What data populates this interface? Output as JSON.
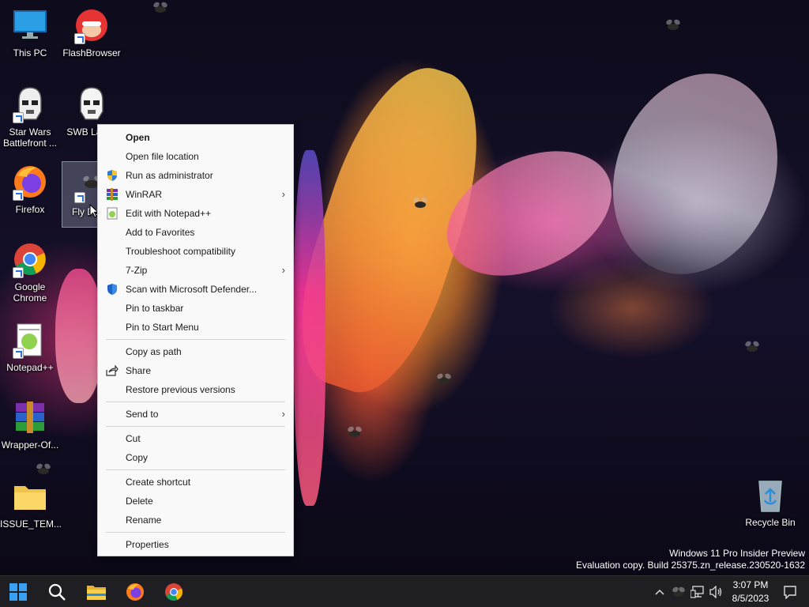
{
  "desktop": {
    "icons": [
      {
        "label": "This PC",
        "icon": "monitor-icon"
      },
      {
        "label": "FlashBrowser",
        "icon": "flash-browser-icon"
      },
      {
        "label": "Star Wars Battlefront ...",
        "icon": "stormtrooper-icon"
      },
      {
        "label": "SWB Launc",
        "icon": "stormtrooper-icon"
      },
      {
        "label": "Firefox",
        "icon": "firefox-icon"
      },
      {
        "label": "Fly Deskt",
        "icon": "fly-icon"
      },
      {
        "label": "Google Chrome",
        "icon": "chrome-icon"
      },
      {
        "label": "Notepad++",
        "icon": "notepad-plus-plus-icon"
      },
      {
        "label": "Wrapper-Of...",
        "icon": "winrar-archive-icon"
      },
      {
        "label": "ISSUE_TEM...",
        "icon": "folder-icon"
      },
      {
        "label": "Recycle Bin",
        "icon": "recycle-bin-icon"
      }
    ]
  },
  "context_menu": {
    "items": [
      {
        "label": "Open"
      },
      {
        "label": "Open file location"
      },
      {
        "label": "Run as administrator"
      },
      {
        "label": "WinRAR"
      },
      {
        "label": "Edit with Notepad++"
      },
      {
        "label": "Add to Favorites"
      },
      {
        "label": "Troubleshoot compatibility"
      },
      {
        "label": "7-Zip"
      },
      {
        "label": "Scan with Microsoft Defender..."
      },
      {
        "label": "Pin to taskbar"
      },
      {
        "label": "Pin to Start Menu"
      },
      {
        "label": "Copy as path"
      },
      {
        "label": "Share"
      },
      {
        "label": "Restore previous versions"
      },
      {
        "label": "Send to"
      },
      {
        "label": "Cut"
      },
      {
        "label": "Copy"
      },
      {
        "label": "Create shortcut"
      },
      {
        "label": "Delete"
      },
      {
        "label": "Rename"
      },
      {
        "label": "Properties"
      }
    ],
    "submenu_arrow": "›"
  },
  "watermark": {
    "line1": "Windows 11 Pro Insider Preview",
    "line2": "Evaluation copy. Build 25375.zn_release.230520-1632"
  },
  "taskbar": {
    "apps": [
      "start-icon",
      "search-icon",
      "file-explorer-icon",
      "firefox-icon",
      "chrome-icon"
    ],
    "clock_time": "3:07 PM",
    "clock_date": "8/5/2023",
    "tray_chevron": "^"
  },
  "colors": {
    "menu_bg": "#f9f9f9",
    "taskbar_bg": "#1f1f23",
    "accent_blue": "#0078d4"
  }
}
